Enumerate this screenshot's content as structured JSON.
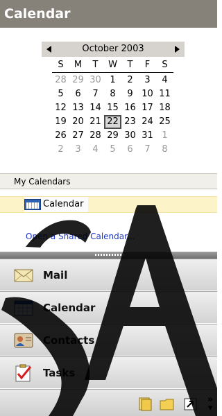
{
  "pane": {
    "title": "Calendar"
  },
  "date_navigator": {
    "month_label": "October 2003",
    "weekday_headers": [
      "S",
      "M",
      "T",
      "W",
      "T",
      "F",
      "S"
    ],
    "weeks": [
      [
        {
          "d": "28",
          "o": true
        },
        {
          "d": "29",
          "o": true
        },
        {
          "d": "30",
          "o": true
        },
        {
          "d": "1"
        },
        {
          "d": "2"
        },
        {
          "d": "3"
        },
        {
          "d": "4"
        }
      ],
      [
        {
          "d": "5"
        },
        {
          "d": "6"
        },
        {
          "d": "7"
        },
        {
          "d": "8"
        },
        {
          "d": "9"
        },
        {
          "d": "10"
        },
        {
          "d": "11"
        }
      ],
      [
        {
          "d": "12"
        },
        {
          "d": "13"
        },
        {
          "d": "14"
        },
        {
          "d": "15"
        },
        {
          "d": "16"
        },
        {
          "d": "17"
        },
        {
          "d": "18"
        }
      ],
      [
        {
          "d": "19"
        },
        {
          "d": "20"
        },
        {
          "d": "21"
        },
        {
          "d": "22",
          "today": true
        },
        {
          "d": "23"
        },
        {
          "d": "24"
        },
        {
          "d": "25"
        }
      ],
      [
        {
          "d": "26"
        },
        {
          "d": "27"
        },
        {
          "d": "28"
        },
        {
          "d": "29"
        },
        {
          "d": "30"
        },
        {
          "d": "31"
        },
        {
          "d": "1",
          "o": true
        }
      ],
      [
        {
          "d": "2",
          "o": true
        },
        {
          "d": "3",
          "o": true
        },
        {
          "d": "4",
          "o": true
        },
        {
          "d": "5",
          "o": true
        },
        {
          "d": "6",
          "o": true
        },
        {
          "d": "7",
          "o": true
        },
        {
          "d": "8",
          "o": true
        }
      ]
    ]
  },
  "my_calendars": {
    "header": "My Calendars",
    "items": [
      {
        "label": "Calendar",
        "icon": "calendar-icon",
        "selected": true
      }
    ],
    "open_shared_link": "Open a Shared Calendar..."
  },
  "navigation": {
    "buttons": [
      {
        "name": "mail",
        "label": "Mail",
        "icon": "mail-icon"
      },
      {
        "name": "calendar",
        "label": "Calendar",
        "icon": "calendar-icon"
      },
      {
        "name": "contacts",
        "label": "Contacts",
        "icon": "contacts-icon"
      },
      {
        "name": "tasks",
        "label": "Tasks",
        "icon": "tasks-icon"
      }
    ],
    "bottom_icons": [
      "notes-icon",
      "folder-list-icon",
      "shortcuts-icon",
      "configure-buttons-icon"
    ]
  },
  "colors": {
    "title_bar": "#868279",
    "selected_item": "#fdf3c9",
    "link": "#1f38c8",
    "today_border": "#4a4a4a"
  }
}
